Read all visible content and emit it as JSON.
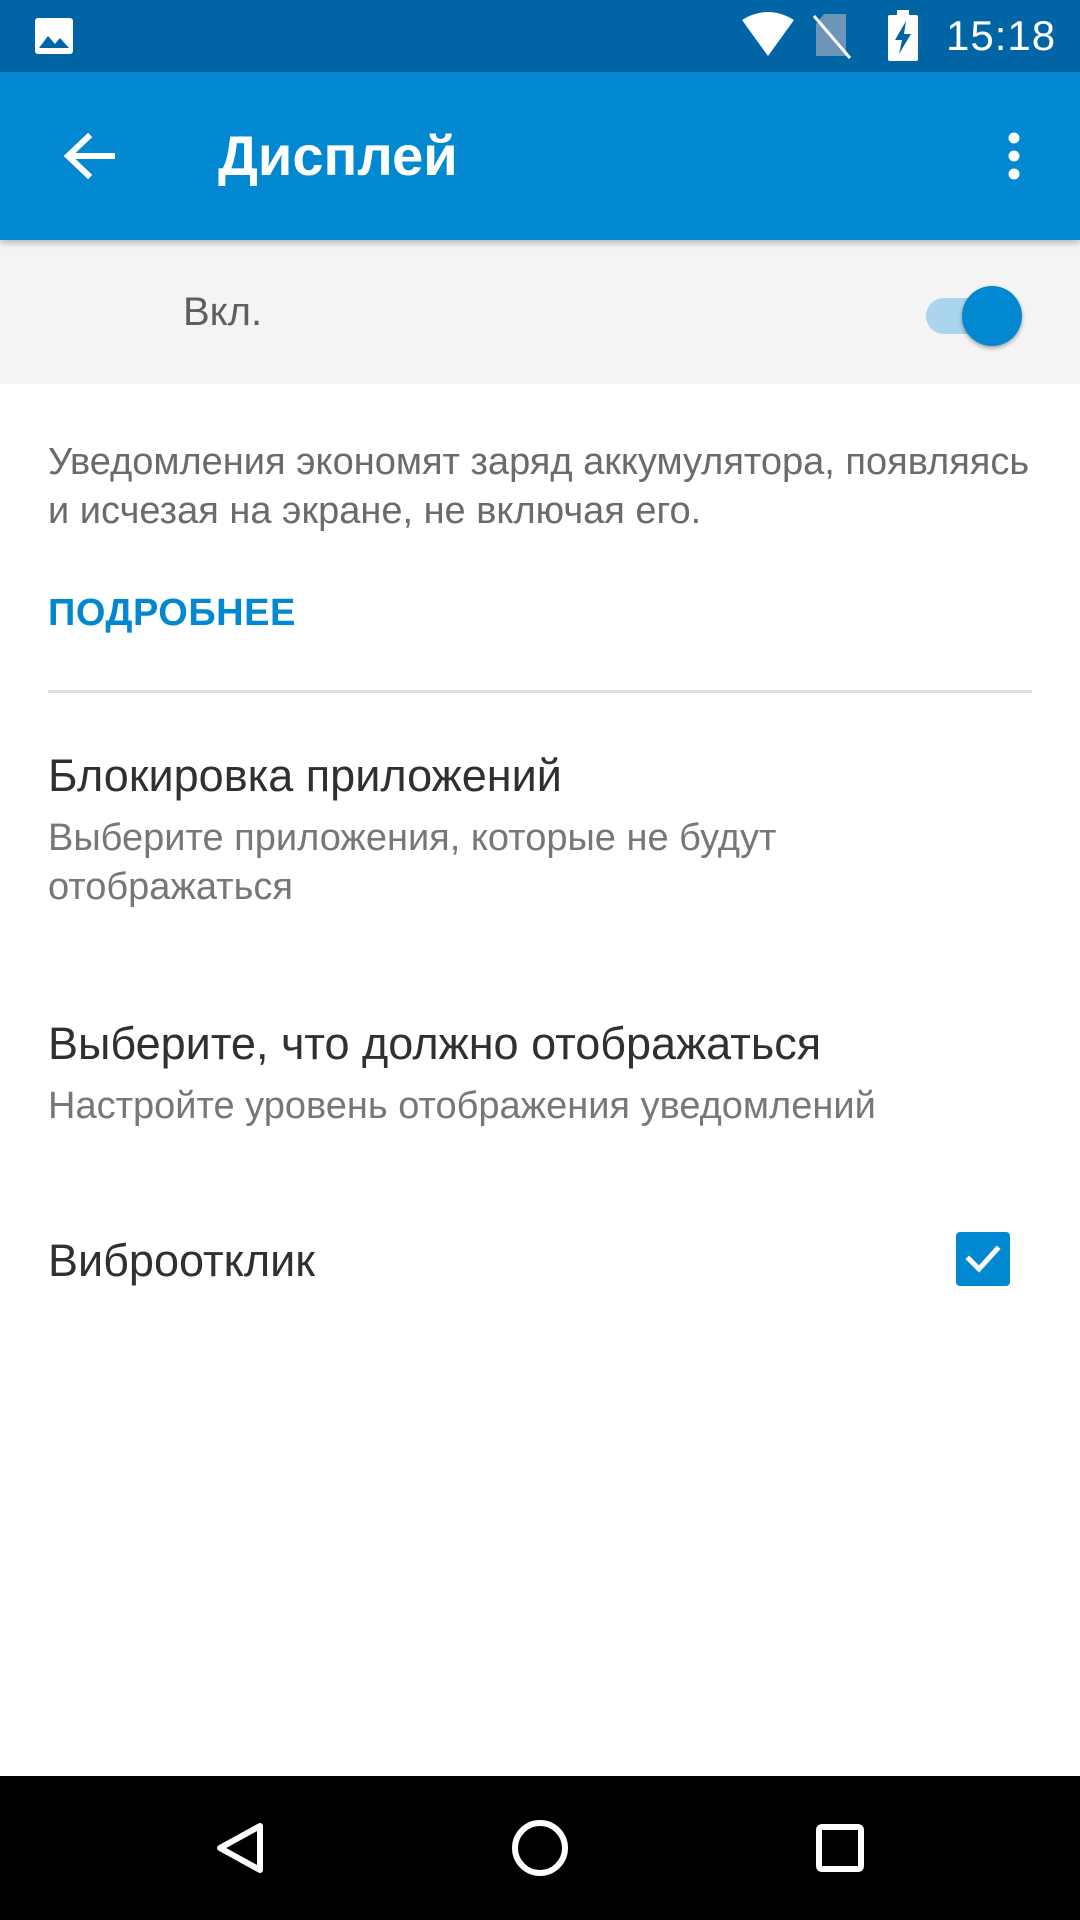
{
  "status_bar": {
    "time": "15:18",
    "icons": [
      "gallery-icon",
      "wifi-icon",
      "no-sim-icon",
      "battery-charging-icon"
    ]
  },
  "app_bar": {
    "title": "Дисплей",
    "back_icon": "arrow-back-icon",
    "menu_icon": "more-vert-icon"
  },
  "master_switch": {
    "label": "Вкл.",
    "on": true
  },
  "description": "Уведомления экономят заряд аккумулятора, появляясь и исчезая на экране, не включая его.",
  "learn_more_label": "ПОДРОБНЕЕ",
  "preferences": [
    {
      "title": "Блокировка приложений",
      "summary": "Выберите приложения, которые не будут отображаться"
    },
    {
      "title": "Выберите, что должно отображаться",
      "summary": "Настройте уровень отображения уведомлений"
    },
    {
      "title": "Виброотклик",
      "checked": true
    }
  ],
  "nav_bar": {
    "icons": [
      "nav-back-icon",
      "nav-home-icon",
      "nav-recents-icon"
    ]
  },
  "colors": {
    "status_bar": "#0165A5",
    "app_bar": "#0288D1",
    "accent": "#0288D1",
    "switch_track": "#A9D6EE"
  }
}
